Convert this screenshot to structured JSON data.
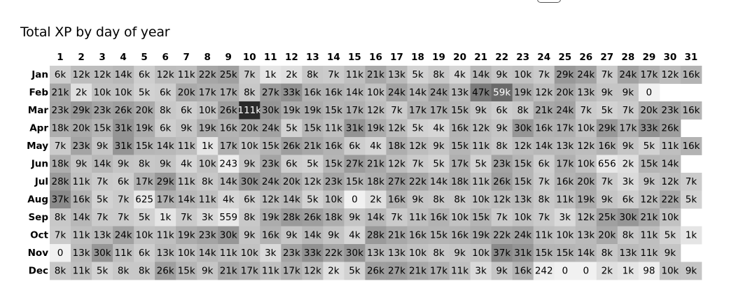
{
  "chart_data": {
    "type": "heatmap",
    "title": "Total XP by day of year",
    "columns": [
      "1",
      "2",
      "3",
      "4",
      "5",
      "6",
      "7",
      "8",
      "9",
      "10",
      "11",
      "12",
      "13",
      "14",
      "15",
      "16",
      "17",
      "18",
      "19",
      "20",
      "21",
      "22",
      "23",
      "24",
      "25",
      "26",
      "27",
      "28",
      "29",
      "30",
      "31"
    ],
    "rows": [
      "Jan",
      "Feb",
      "Mar",
      "Apr",
      "May",
      "Jun",
      "Jul",
      "Aug",
      "Sep",
      "Oct",
      "Nov",
      "Dec"
    ],
    "values": [
      [
        "6k",
        "12k",
        "12k",
        "14k",
        "6k",
        "12k",
        "11k",
        "22k",
        "25k",
        "7k",
        "1k",
        "2k",
        "8k",
        "7k",
        "11k",
        "21k",
        "13k",
        "5k",
        "8k",
        "4k",
        "14k",
        "9k",
        "10k",
        "7k",
        "29k",
        "24k",
        "7k",
        "24k",
        "17k",
        "12k",
        "16k"
      ],
      [
        "21k",
        "2k",
        "10k",
        "10k",
        "5k",
        "6k",
        "20k",
        "17k",
        "17k",
        "8k",
        "27k",
        "33k",
        "16k",
        "16k",
        "14k",
        "10k",
        "24k",
        "14k",
        "24k",
        "13k",
        "47k",
        "59k",
        "19k",
        "12k",
        "20k",
        "13k",
        "9k",
        "9k",
        "0",
        null,
        null
      ],
      [
        "23k",
        "29k",
        "23k",
        "26k",
        "20k",
        "8k",
        "6k",
        "10k",
        "26k",
        "111k",
        "30k",
        "19k",
        "19k",
        "15k",
        "17k",
        "12k",
        "7k",
        "17k",
        "17k",
        "15k",
        "9k",
        "6k",
        "8k",
        "21k",
        "24k",
        "7k",
        "5k",
        "7k",
        "20k",
        "23k",
        "16k"
      ],
      [
        "18k",
        "20k",
        "15k",
        "31k",
        "19k",
        "6k",
        "9k",
        "19k",
        "16k",
        "20k",
        "24k",
        "5k",
        "15k",
        "11k",
        "31k",
        "19k",
        "12k",
        "5k",
        "4k",
        "16k",
        "12k",
        "9k",
        "30k",
        "16k",
        "17k",
        "10k",
        "29k",
        "17k",
        "33k",
        "26k",
        null
      ],
      [
        "7k",
        "23k",
        "9k",
        "31k",
        "15k",
        "14k",
        "11k",
        "1k",
        "17k",
        "10k",
        "15k",
        "26k",
        "21k",
        "16k",
        "6k",
        "4k",
        "18k",
        "12k",
        "9k",
        "15k",
        "11k",
        "8k",
        "12k",
        "14k",
        "13k",
        "12k",
        "16k",
        "9k",
        "5k",
        "11k",
        "16k"
      ],
      [
        "18k",
        "9k",
        "14k",
        "9k",
        "8k",
        "9k",
        "4k",
        "10k",
        "243",
        "9k",
        "23k",
        "6k",
        "5k",
        "15k",
        "27k",
        "21k",
        "12k",
        "7k",
        "5k",
        "17k",
        "5k",
        "23k",
        "15k",
        "6k",
        "17k",
        "10k",
        "656",
        "2k",
        "15k",
        "14k",
        null
      ],
      [
        "28k",
        "11k",
        "7k",
        "6k",
        "17k",
        "29k",
        "11k",
        "8k",
        "14k",
        "30k",
        "24k",
        "20k",
        "12k",
        "23k",
        "15k",
        "18k",
        "27k",
        "22k",
        "14k",
        "18k",
        "11k",
        "26k",
        "15k",
        "7k",
        "16k",
        "20k",
        "7k",
        "3k",
        "9k",
        "12k",
        "7k"
      ],
      [
        "37k",
        "16k",
        "5k",
        "7k",
        "625",
        "17k",
        "14k",
        "11k",
        "4k",
        "6k",
        "12k",
        "14k",
        "5k",
        "10k",
        "0",
        "2k",
        "16k",
        "9k",
        "8k",
        "8k",
        "10k",
        "12k",
        "13k",
        "8k",
        "11k",
        "19k",
        "9k",
        "6k",
        "12k",
        "22k",
        "5k"
      ],
      [
        "8k",
        "14k",
        "7k",
        "7k",
        "5k",
        "1k",
        "7k",
        "3k",
        "559",
        "8k",
        "19k",
        "28k",
        "26k",
        "18k",
        "9k",
        "14k",
        "7k",
        "11k",
        "16k",
        "10k",
        "15k",
        "7k",
        "10k",
        "7k",
        "3k",
        "12k",
        "25k",
        "30k",
        "21k",
        "10k",
        null
      ],
      [
        "7k",
        "11k",
        "13k",
        "24k",
        "10k",
        "11k",
        "19k",
        "23k",
        "30k",
        "9k",
        "16k",
        "9k",
        "14k",
        "9k",
        "4k",
        "28k",
        "21k",
        "16k",
        "15k",
        "16k",
        "19k",
        "22k",
        "24k",
        "11k",
        "10k",
        "13k",
        "20k",
        "8k",
        "11k",
        "5k",
        "1k"
      ],
      [
        "0",
        "13k",
        "30k",
        "11k",
        "6k",
        "13k",
        "10k",
        "14k",
        "11k",
        "10k",
        "3k",
        "23k",
        "33k",
        "22k",
        "30k",
        "13k",
        "13k",
        "10k",
        "8k",
        "9k",
        "10k",
        "37k",
        "31k",
        "15k",
        "15k",
        "14k",
        "8k",
        "13k",
        "11k",
        "9k",
        null
      ],
      [
        "8k",
        "11k",
        "5k",
        "8k",
        "8k",
        "26k",
        "15k",
        "9k",
        "21k",
        "17k",
        "11k",
        "17k",
        "12k",
        "2k",
        "5k",
        "26k",
        "27k",
        "21k",
        "17k",
        "11k",
        "3k",
        "9k",
        "16k",
        "242",
        "0",
        "0",
        "2k",
        "1k",
        "98",
        "10k",
        "9k"
      ]
    ],
    "color_scale": {
      "min_color": "#f1f1f1",
      "max_color": "#2a2a2a",
      "light_text": "#ffffff",
      "dark_text": "#000000"
    },
    "grid": false,
    "legend": "none"
  }
}
